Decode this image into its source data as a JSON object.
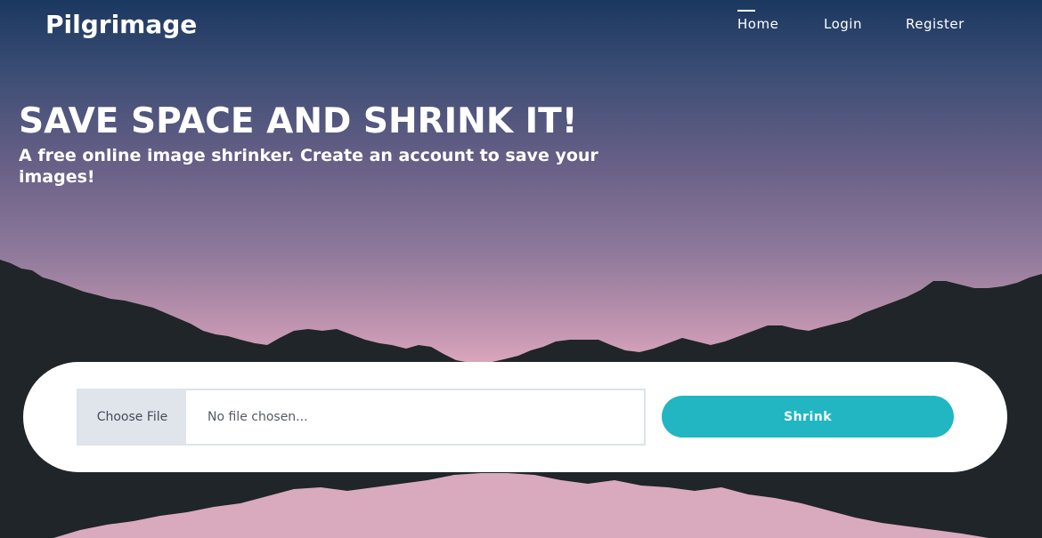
{
  "brand": {
    "name": "Pilgrimage"
  },
  "nav": {
    "items": [
      {
        "label": "Home",
        "active": true
      },
      {
        "label": "Login",
        "active": false
      },
      {
        "label": "Register",
        "active": false
      }
    ]
  },
  "hero": {
    "title": "SAVE SPACE AND SHRINK IT!",
    "subtitle": "A free online image shrinker. Create an account to save your images!"
  },
  "upload": {
    "choose_label": "Choose File",
    "file_placeholder": "No file chosen...",
    "submit_label": "Shrink"
  },
  "colors": {
    "sky_top": "#1b3860",
    "sky_horizon": "#e6b0c4",
    "mountain": "#1f2528",
    "accent": "#21b6c2",
    "card": "#ffffff"
  }
}
